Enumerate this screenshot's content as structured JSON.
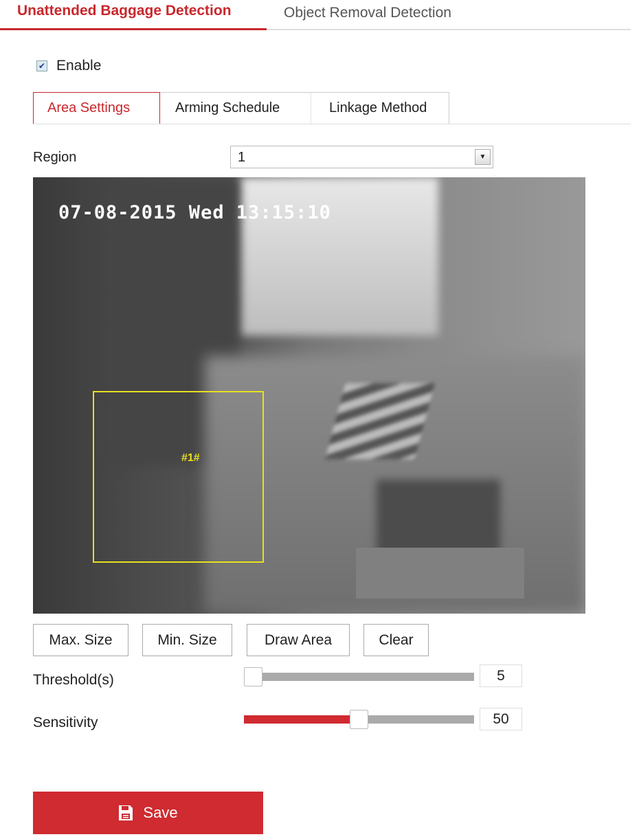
{
  "tabs": [
    {
      "label": "Unattended Baggage Detection",
      "active": true
    },
    {
      "label": "Object Removal Detection",
      "active": false
    }
  ],
  "enable": {
    "label": "Enable",
    "checked": true
  },
  "steps": [
    {
      "label": "Area Settings",
      "active": true
    },
    {
      "label": "Arming Schedule"
    },
    {
      "label": "Linkage Method"
    }
  ],
  "region": {
    "label": "Region",
    "value": "1"
  },
  "video": {
    "timestamp_date": "07-08-2015 Wed",
    "timestamp_time": "13:15:10",
    "region_label": "#1#",
    "region_color": "#e8e020"
  },
  "buttons": {
    "max_size": "Max. Size",
    "min_size": "Min. Size",
    "draw_area": "Draw Area",
    "clear": "Clear"
  },
  "threshold": {
    "label": "Threshold(s)",
    "value": "5",
    "fraction": 0
  },
  "sensitivity": {
    "label": "Sensitivity",
    "value": "50",
    "fraction": 0.5
  },
  "save": {
    "label": "Save",
    "icon": "floppy-disk-icon"
  },
  "colors": {
    "accent": "#c8282d"
  }
}
